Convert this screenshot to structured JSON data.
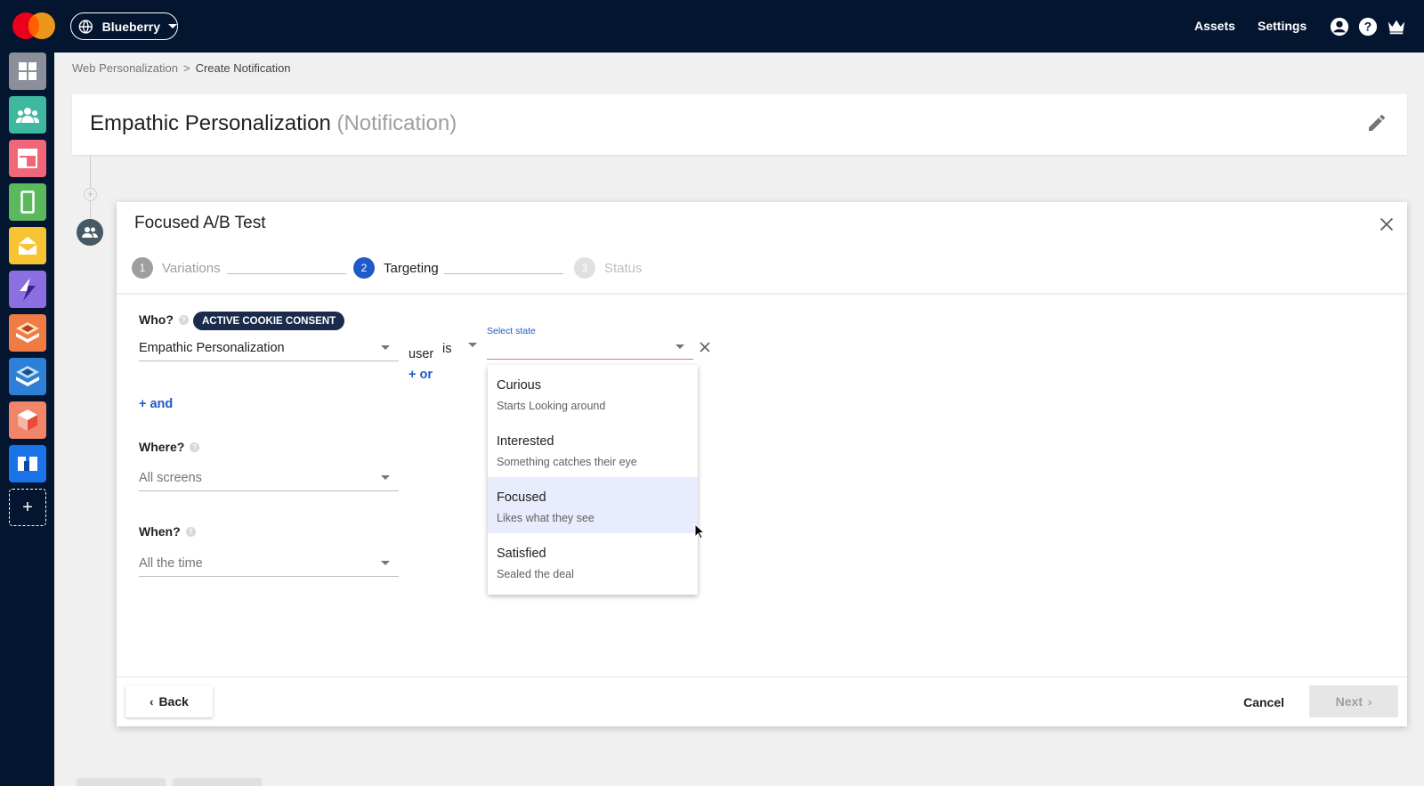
{
  "topbar": {
    "workspace": "Blueberry",
    "nav": [
      "Assets",
      "Settings"
    ],
    "icons": [
      "account-icon",
      "help-icon",
      "crown-icon"
    ]
  },
  "rail": {
    "items": [
      {
        "name": "dashboard",
        "color": "#8a8f99"
      },
      {
        "name": "audiences",
        "color": "#3fb8a0"
      },
      {
        "name": "web-personalization",
        "color": "#f0677a"
      },
      {
        "name": "mobile",
        "color": "#5cb85c"
      },
      {
        "name": "email",
        "color": "#f7c433"
      },
      {
        "name": "journeys",
        "color": "#8b6fe0"
      },
      {
        "name": "content",
        "color": "#f07c45"
      },
      {
        "name": "layers",
        "color": "#2e7fd6"
      },
      {
        "name": "products",
        "color": "#f0856a"
      },
      {
        "name": "dynamic",
        "color": "#1a73e8"
      }
    ],
    "add_label": "+"
  },
  "breadcrumb": {
    "parent": "Web Personalization",
    "separator": ">",
    "current": "Create Notification"
  },
  "title": {
    "main": "Empathic Personalization",
    "type": "(Notification)"
  },
  "modal": {
    "title": "Focused A/B Test",
    "steps": [
      {
        "num": "1",
        "label": "Variations",
        "state": "done"
      },
      {
        "num": "2",
        "label": "Targeting",
        "state": "active"
      },
      {
        "num": "3",
        "label": "Status",
        "state": "pending"
      }
    ],
    "who": {
      "label": "Who?",
      "badge": "ACTIVE COOKIE CONSENT",
      "audience_value": "Empathic Personalization",
      "user_label": "user",
      "operator": "is",
      "state_label": "Select state",
      "or_label": "+ or",
      "and_label": "+ and"
    },
    "where": {
      "label": "Where?",
      "value": "All screens"
    },
    "when": {
      "label": "When?",
      "value": "All the time"
    },
    "dropdown_options": [
      {
        "name": "Curious",
        "desc": "Starts Looking around",
        "selected": false
      },
      {
        "name": "Interested",
        "desc": "Something catches their eye",
        "selected": false
      },
      {
        "name": "Focused",
        "desc": "Likes what they see",
        "selected": true
      },
      {
        "name": "Satisfied",
        "desc": "Sealed the deal",
        "selected": false
      }
    ],
    "footer": {
      "back": "Back",
      "cancel": "Cancel",
      "next": "Next"
    }
  },
  "colors": {
    "navy": "#041530",
    "accent": "#1e5ac8",
    "badge": "#1a2b4c"
  }
}
